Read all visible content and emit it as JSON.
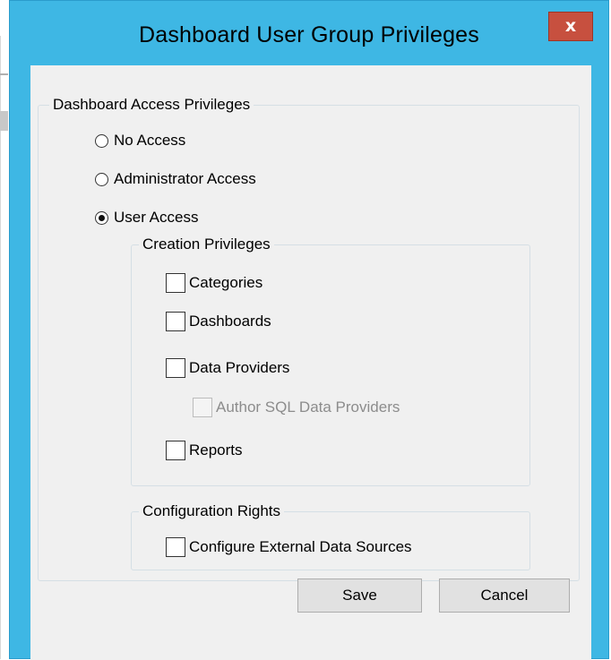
{
  "window": {
    "title": "Dashboard User Group Privileges",
    "close_glyph": "x",
    "close_icon": "close-icon",
    "accent_color": "#3eb7e4",
    "close_color": "#c7503f"
  },
  "access_group": {
    "legend": "Dashboard Access Privileges",
    "options": [
      {
        "label": "No Access",
        "checked": false
      },
      {
        "label": "Administrator Access",
        "checked": false
      },
      {
        "label": "User Access",
        "checked": true
      }
    ]
  },
  "creation_group": {
    "legend": "Creation Privileges",
    "items": [
      {
        "label": "Categories",
        "checked": false,
        "enabled": true
      },
      {
        "label": "Dashboards",
        "checked": false,
        "enabled": true
      },
      {
        "label": "Data Providers",
        "checked": false,
        "enabled": true
      },
      {
        "label": "Author SQL Data Providers",
        "checked": false,
        "enabled": false
      },
      {
        "label": "Reports",
        "checked": false,
        "enabled": true
      }
    ]
  },
  "configuration_group": {
    "legend": "Configuration Rights",
    "items": [
      {
        "label": "Configure External Data Sources",
        "checked": false,
        "enabled": true
      }
    ]
  },
  "buttons": {
    "save": "Save",
    "cancel": "Cancel"
  }
}
